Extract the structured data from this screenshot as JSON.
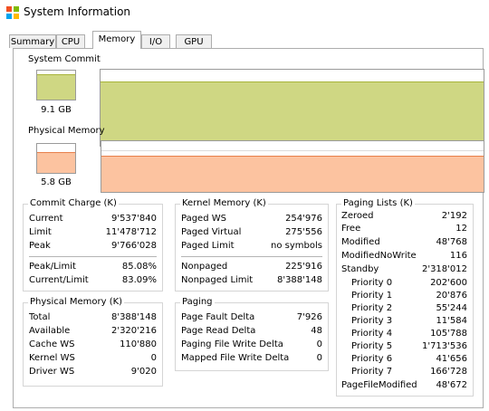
{
  "window": {
    "title": "System Information"
  },
  "tabs": [
    {
      "label": "Summary"
    },
    {
      "label": "CPU"
    },
    {
      "label": "Memory",
      "active": true
    },
    {
      "label": "I/O"
    },
    {
      "label": "GPU"
    }
  ],
  "system_commit": {
    "label": "System Commit",
    "value": "9.1 GB",
    "fraction": 0.83,
    "color": "#cfd783",
    "line_color": "#a8b43a"
  },
  "physical_memory": {
    "label": "Physical Memory",
    "value": "5.8 GB",
    "fraction": 0.69,
    "color": "#fcc3a0",
    "line_color": "#e8804c"
  },
  "commit_charge": {
    "title": "Commit Charge (K)",
    "current_label": "Current",
    "current": "9'537'840",
    "limit_label": "Limit",
    "limit": "11'478'712",
    "peak_label": "Peak",
    "peak": "9'766'028",
    "peak_limit_label": "Peak/Limit",
    "peak_limit": "85.08%",
    "current_limit_label": "Current/Limit",
    "current_limit": "83.09%"
  },
  "physical_memory_k": {
    "title": "Physical Memory (K)",
    "total_label": "Total",
    "total": "8'388'148",
    "available_label": "Available",
    "available": "2'320'216",
    "cache_ws_label": "Cache WS",
    "cache_ws": "110'880",
    "kernel_ws_label": "Kernel WS",
    "kernel_ws": "0",
    "driver_ws_label": "Driver WS",
    "driver_ws": "9'020"
  },
  "kernel_memory": {
    "title": "Kernel Memory (K)",
    "paged_ws_label": "Paged WS",
    "paged_ws": "254'976",
    "paged_virtual_label": "Paged Virtual",
    "paged_virtual": "275'556",
    "paged_limit_label": "Paged Limit",
    "paged_limit": "no symbols",
    "nonpaged_label": "Nonpaged",
    "nonpaged": "225'916",
    "nonpaged_limit_label": "Nonpaged Limit",
    "nonpaged_limit": "8'388'148"
  },
  "paging": {
    "title": "Paging",
    "fault_label": "Page Fault Delta",
    "fault": "7'926",
    "read_label": "Page Read Delta",
    "read": "48",
    "file_write_label": "Paging File Write Delta",
    "file_write": "0",
    "mapped_write_label": "Mapped File Write Delta",
    "mapped_write": "0"
  },
  "paging_lists": {
    "title": "Paging Lists (K)",
    "zeroed_label": "Zeroed",
    "zeroed": "2'192",
    "free_label": "Free",
    "free": "12",
    "modified_label": "Modified",
    "modified": "48'768",
    "modified_nowrite_label": "ModifiedNoWrite",
    "modified_nowrite": "116",
    "standby_label": "Standby",
    "standby": "2'318'012",
    "priorities": [
      {
        "label": "Priority 0",
        "value": "202'600"
      },
      {
        "label": "Priority 1",
        "value": "20'876"
      },
      {
        "label": "Priority 2",
        "value": "55'244"
      },
      {
        "label": "Priority 3",
        "value": "11'584"
      },
      {
        "label": "Priority 4",
        "value": "105'788"
      },
      {
        "label": "Priority 5",
        "value": "1'713'536"
      },
      {
        "label": "Priority 6",
        "value": "41'656"
      },
      {
        "label": "Priority 7",
        "value": "166'728"
      }
    ],
    "pagefile_modified_label": "PageFileModified",
    "pagefile_modified": "48'672"
  }
}
